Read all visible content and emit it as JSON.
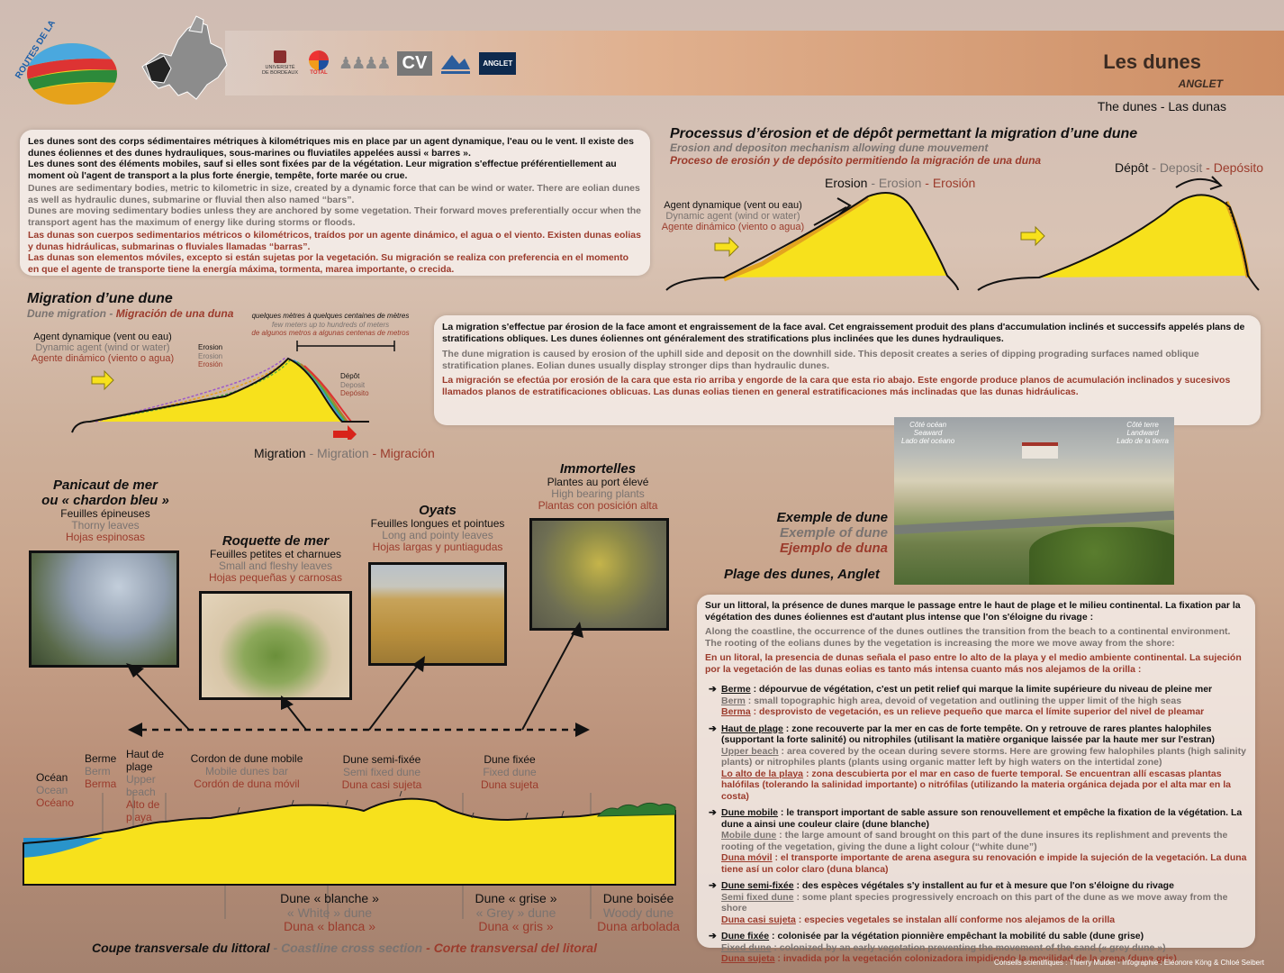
{
  "logo": {
    "text": "ROUTES DE LA TERRE"
  },
  "sponsors": [
    "UNIVERSITÉ DE BORDEAUX",
    "TOTAL",
    "CV",
    "ANGLET"
  ],
  "header": {
    "title": "Les dunes",
    "subtitle": "ANGLET",
    "translations": "The dunes - Las dunas"
  },
  "intro": {
    "fr": "Les dunes sont des corps sédimentaires métriques à kilométriques mis en place par un agent dynamique, l'eau ou le vent. Il existe des dunes éoliennes et des dunes hydrauliques, sous-marines ou fluviatiles appelées aussi « barres ».\nLes dunes sont des éléments mobiles, sauf si elles sont fixées par de la végétation. Leur migration s'effectue préférentiellement au moment où l'agent de transport a la plus forte énergie, tempête, forte marée ou crue.",
    "en": "Dunes are sedimentary bodies, metric to kilometric in size, created by a dynamic force that can be wind or water. There are eolian dunes as well as hydraulic dunes, submarine or fluvial then also named “bars”.\nDunes are moving sedimentary bodies unless they are anchored by some vegetation. Their forward moves preferentially occur when the transport agent has the maximum of energy like during storms or floods.",
    "es": "Las dunas son cuerpos sedimentarios métricos o kilométricos, traídos por un agente dinámico, el agua o el viento. Existen dunas eolias y dunas hidráulicas, submarinas o fluviales llamadas “barras”.\nLas dunas son elementos móviles, excepto si están sujetas por la vegetación. Su migración se realiza con preferencia en el momento en que el agente de transporte tiene la energía máxima, tormenta, marea importante, o crecida."
  },
  "erosion": {
    "title": "Processus d’érosion et de dépôt permettant la migration d’une dune",
    "en": "Erosion and depositon mechanism allowing dune mouvement",
    "es": "Proceso de erosión y de depósito permitiendo la migración  de una duna",
    "agent_fr": "Agent dynamique (vent ou eau)",
    "agent_en": "Dynamic agent (wind or water)",
    "agent_es": "Agente dinámico (viento o agua)",
    "erosion_fr": "Erosion",
    "erosion_en": "Erosion",
    "erosion_es": "Erosión",
    "depot_fr": "Dépôt",
    "depot_en": "Deposit",
    "depot_es": "Depósito"
  },
  "migration": {
    "title": "Migration d’une dune",
    "en": "Dune migration",
    "es": "Migración de una duna",
    "distance_fr": "quelques mètres à quelques centaines de mètres",
    "distance_en": "few meters up to hundreds of meters",
    "distance_es": "de algunos metros a algunas centenas de metros",
    "agent_fr": "Agent dynamique (vent ou eau)",
    "agent_en": "Dynamic agent (wind or water)",
    "agent_es": "Agente dinámico (viento o agua)",
    "erosion_fr": "Erosion",
    "erosion_en": "Erosion",
    "erosion_es": "Erosión",
    "depot_fr": "Dépôt",
    "depot_en": "Deposit",
    "depot_es": "Depósito",
    "caption_fr": "Migration",
    "caption_en": "Migration",
    "caption_es": "Migración"
  },
  "migration_text": {
    "fr": "La migration s'effectue par érosion de la face amont et engraissement de la face aval. Cet engraissement produit des plans d'accumulation inclinés et successifs appelés plans de stratifications obliques. Les dunes éoliennes ont généralement des stratifications plus inclinées que les dunes hydrauliques.",
    "en": "The dune migration is caused by erosion of the uphill side and deposit on the downhill side. This deposit creates a series of dipping prograding surfaces named oblique stratification planes. Eolian dunes usually display stronger dips than hydraulic dunes.",
    "es": "La migración se efectúa por erosión de la cara que esta rio arriba y engorde de la cara que esta rio abajo. Este engorde produce planos de acumulación inclinados y sucesivos llamados planos de estratificaciones oblicuas. Las dunas eolias tienen en general estratificaciones más  inclinadas que las dunas hidráulicas."
  },
  "plants": [
    {
      "title": "Panicaut de mer\nou « chardon bleu »",
      "fr": "Feuilles épineuses",
      "en": "Thorny leaves",
      "es": "Hojas espinosas",
      "icon": "sea-holly-photo"
    },
    {
      "title": "Roquette de mer",
      "fr": "Feuilles petites et charnues",
      "en": "Small and fleshy leaves",
      "es": "Hojas pequeñas y carnosas",
      "icon": "sea-rocket-photo"
    },
    {
      "title": "Oyats",
      "fr": "Feuilles longues et pointues",
      "en": "Long and pointy leaves",
      "es": "Hojas largas y puntiagudas",
      "icon": "marram-grass-photo"
    },
    {
      "title": "Immortelles",
      "fr": "Plantes au port élevé",
      "en": "High bearing plants",
      "es": "Plantas con posición alta",
      "icon": "everlasting-photo"
    }
  ],
  "example": {
    "fr": "Exemple de dune",
    "en": "Exemple of dune",
    "es": "Ejemplo de duna",
    "place": "Plage des dunes, Anglet",
    "ocean_fr": "Côté océan",
    "ocean_en": "Seaward",
    "ocean_es": "Lado del océano",
    "land_fr": "Côté terre",
    "land_en": "Landward",
    "land_es": "Lado de la tierra"
  },
  "zones": [
    {
      "fr": "Océan",
      "en": "Ocean",
      "es": "Océano"
    },
    {
      "fr": "Berme",
      "en": "Berm",
      "es": "Berma"
    },
    {
      "fr": "Haut de plage",
      "en": "Upper beach",
      "es": "Alto de playa"
    },
    {
      "fr": "Cordon de dune mobile",
      "en": "Mobile dunes bar",
      "es": "Cordón de duna móvil"
    },
    {
      "fr": "Dune semi-fixée",
      "en": "Semi fixed dune",
      "es": "Duna casi sujeta"
    },
    {
      "fr": "Dune fixée",
      "en": "Fixed dune",
      "es": "Duna sujeta"
    }
  ],
  "dune_colors": [
    {
      "fr": "Dune « blanche »",
      "en": "« White » dune",
      "es": "Duna « blanca »"
    },
    {
      "fr": "Dune « grise »",
      "en": "« Grey » dune",
      "es": "Duna « gris »"
    },
    {
      "fr": "Dune boisée",
      "en": "Woody dune",
      "es": "Duna arbolada"
    }
  ],
  "section_caption": {
    "fr": "Coupe transversale du littoral",
    "en": "Coastline cross section",
    "es": "Corte transversal del litoral"
  },
  "coast": {
    "intro_fr": "Sur un littoral, la présence de dunes marque le passage entre le haut de plage et le milieu continental. La fixation par la végétation des dunes éoliennes est d'autant plus intense que l'on s'éloigne du rivage :",
    "intro_en": "Along  the coastline, the occurrence of the dunes outlines the transition from the beach to a continental environment. The rooting of the eolians dunes by the vegetation is increasing the more we move away from the shore:",
    "intro_es": "En un litoral, la presencia de dunas señala el paso entre lo alto de la playa y el medio ambiente continental. La sujeción por la vegetación de las dunas eolias es tanto más intensa cuanto más nos alejamos de la orilla :",
    "items": [
      {
        "term_fr": "Berme",
        "fr": " : dépourvue de végétation, c'est un petit relief qui marque la limite supérieure du niveau de pleine mer",
        "term_en": "Berm",
        "en": " : small topographic high area, devoid of vegetation and outlining the upper limit of the high seas",
        "term_es": "Berma",
        "es": " : desprovisto de vegetación, es un relieve pequeño que marca el límite superior del nivel de pleamar"
      },
      {
        "term_fr": "Haut de plage",
        "fr": " : zone recouverte par la mer en cas de forte tempête. On y retrouve de rares plantes halophiles (supportant la forte salinité) ou nitrophiles (utilisant la matière organique laissée par la haute mer sur l'estran)",
        "term_en": "Upper beach",
        "en": " : area covered by the ocean during severe storms. Here are growing few halophiles plants (high salinity plants) or nitrophiles plants (plants using organic matter left by high waters on the intertidal zone)",
        "term_es": "Lo alto de la playa",
        "es": " : zona descubierta por el mar en caso de fuerte temporal. Se encuentran allí escasas  plantas halófilas (tolerando la salinidad importante) o nitrófilas (utilizando la materia orgánica dejada por el alta mar en la costa)"
      },
      {
        "term_fr": "Dune mobile",
        "fr": " : le transport important de sable assure son renouvellement et empêche la fixation de la végétation. La dune a ainsi une couleur claire (dune blanche)",
        "term_en": "Mobile dune",
        "en": " : the large amount of sand brought on this part of the dune insures its replishment and prevents the rooting of the vegetation, giving the dune a light colour (“white dune”)",
        "term_es": "Duna móvil",
        "es": " : el transporte importante de arena asegura su renovación e impide la sujeción de la vegetación. La duna tiene así un color claro (duna blanca)"
      },
      {
        "term_fr": "Dune semi-fixée",
        "fr": " : des espèces végétales s'y installent au fur et à mesure que l'on s'éloigne du rivage",
        "term_en": "Semi fixed dune",
        "en": " : some plant species progressively encroach on this part of the dune as we move away from the shore",
        "term_es": "Duna casi sujeta",
        "es": " : especies vegetales se instalan allí conforme nos alejamos de la orilla"
      },
      {
        "term_fr": "Dune fixée",
        "fr": " : colonisée par la végétation pionnière empêchant la mobilité du sable (dune grise)",
        "term_en": "Fixed dune",
        "en": " : colonized by an early vegetation preventing the movement of the sand (« grey dune »)",
        "term_es": "Duna sujeta",
        "es": " : invadida por la vegetación colonizadora impidiendo la movilidad de la arena (duna gris)"
      }
    ]
  },
  "credits": "Conseils scientifiques : Thierry Mulder - Infographie : Eléonore Köng & Chloé Seibert",
  "colors": {
    "sand": "#f7e11c",
    "sand_edge": "#e3a41f",
    "ocean": "#1e8fd4",
    "red_text": "#9b3b2c",
    "grey_text": "#7a7370"
  }
}
